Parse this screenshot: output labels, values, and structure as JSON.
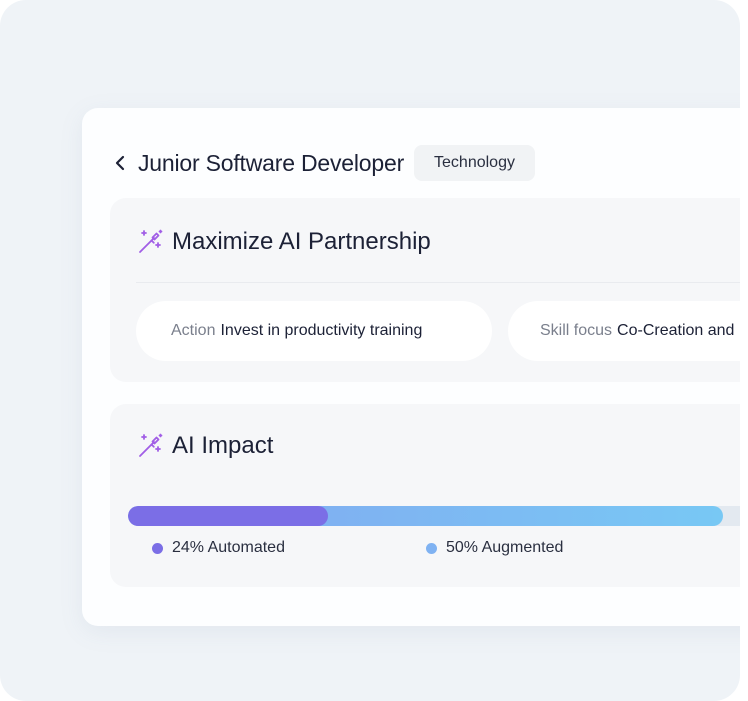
{
  "header": {
    "back_icon": "chevron-left-icon",
    "title": "Junior Software Developer",
    "tag": "Technology"
  },
  "partnership": {
    "icon": "magic-wand-icon",
    "title": "Maximize AI Partnership",
    "action_label": "Action",
    "action_value": "Invest in productivity training",
    "skill_label": "Skill focus",
    "skill_value": "Co-Creation and"
  },
  "impact": {
    "icon": "magic-wand-icon",
    "title": "AI Impact",
    "automated": 24,
    "augmented": 50,
    "automated_label": "24% Automated",
    "augmented_label": "50% Augmented"
  },
  "colors": {
    "automated": "#7b6ee6",
    "augmented": "#7fb2f2",
    "accent_icon": "#a15ee6"
  }
}
